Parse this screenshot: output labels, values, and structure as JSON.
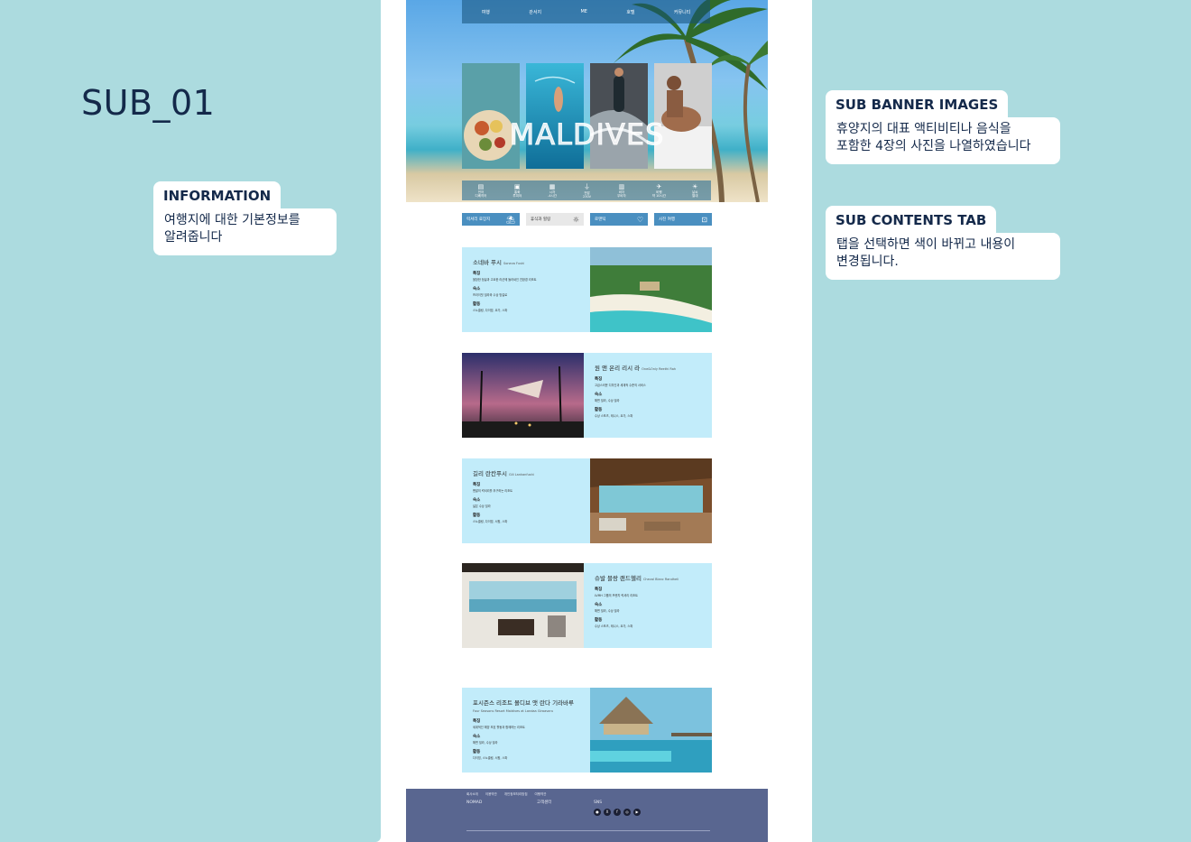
{
  "page_title": "SUB_01",
  "notes": {
    "information": {
      "title": "INFORMATION",
      "body": "여행지에 대한 기본정보를\n알려줍니다"
    },
    "sub_banner": {
      "title": "SUB BANNER IMAGES",
      "body": "휴양지의 대표 액티비티나 음식을\n포함한 4장의 사진을 나열하였습니다"
    },
    "sub_contents": {
      "title": "SUB CONTENTS TAB",
      "body": "탭을 선택하면 색이 바뀌고 내용이\n변경됩니다."
    }
  },
  "hero": {
    "title": "MALDIVES",
    "nav": [
      "여행",
      "관서지",
      "ME",
      "호텔",
      "커뮤니티"
    ],
    "info": [
      {
        "label": "언어",
        "value": "디베히어",
        "icon": "book-icon"
      },
      {
        "label": "통화",
        "value": "루피야",
        "icon": "money-icon"
      },
      {
        "label": "시차",
        "value": "-4시간",
        "icon": "calendar-icon"
      },
      {
        "label": "전압",
        "value": "230V",
        "icon": "plug-icon"
      },
      {
        "label": "비자",
        "value": "무비자",
        "icon": "passport-icon"
      },
      {
        "label": "비행",
        "value": "약 10시간",
        "icon": "plane-icon"
      },
      {
        "label": "날씨",
        "value": "열대",
        "icon": "sun-icon"
      }
    ]
  },
  "tabs": [
    {
      "label": "럭셔리 료장지",
      "icon": "island-icon",
      "active": false
    },
    {
      "label": "휴식과 힐링",
      "icon": "sun-icon",
      "active": true
    },
    {
      "label": "로맨틱",
      "icon": "heart-icon",
      "active": false
    },
    {
      "label": "사진 여행",
      "icon": "camera-icon",
      "active": false
    }
  ],
  "cards": [
    {
      "title": "소네바 푸시",
      "subtitle": "Soneva Fushi",
      "label_feature": "특징",
      "feature": "울창한 정글과 고요한 라군에 둘러싸인 친환경 리조트",
      "label_stay": "숙소",
      "stay": "프라이빗 빌라와 수상 방갈로",
      "label_activity": "활동",
      "activity": "스노클링, 다이빙, 요가, 스파"
    },
    {
      "title": "원 앤 온리 리시 라",
      "subtitle": "One&Only Reethi Rah",
      "label_feature": "특징",
      "feature": "고급스러운 디자인과 세계적 수준의 서비스",
      "label_stay": "숙소",
      "stay": "해변 빌라, 수상 빌라",
      "label_activity": "활동",
      "activity": "수상 스포츠, 테니스, 요가, 스파"
    },
    {
      "title": "길리 란칸푸시",
      "subtitle": "Gili Lankanfushi",
      "label_feature": "특징",
      "feature": "맨발의 럭셔리를 추구하는 리조트",
      "label_stay": "숙소",
      "stay": "넓은 수상 빌라",
      "label_activity": "활동",
      "activity": "스노클링, 다이빙, 서핑, 스파"
    },
    {
      "title": "슈발 블랑 랜드헬리",
      "subtitle": "Cheval Blanc Randheli",
      "label_feature": "특징",
      "feature": "LVMH 그룹의 프렌치 럭셔리 리조트",
      "label_stay": "숙소",
      "stay": "해변 빌라, 수상 빌라",
      "label_activity": "활동",
      "activity": "수상 스포츠, 테니스, 요가, 스파"
    },
    {
      "title": "포시즌스 리조트 몰디브 앳 란다 기라바루",
      "subtitle": "Four Seasons Resort Maldives at Landaa Giraavaru",
      "label_feature": "특징",
      "feature": "세계적인 해양 보호 활동과 함께하는 리조트",
      "label_stay": "숙소",
      "stay": "해변 빌라, 수상 빌라",
      "label_activity": "활동",
      "activity": "다이빙, 스노클링, 서핑, 스파"
    }
  ],
  "footer": {
    "links": [
      "회사소개",
      "이용약관",
      "개인정보처리방침",
      "여행약관"
    ],
    "brand": "NOMAD",
    "contact_title": "고객센터",
    "social_title": "SNS",
    "social": [
      "kakao-icon",
      "x-icon",
      "facebook-icon",
      "instagram-icon",
      "youtube-icon"
    ]
  }
}
